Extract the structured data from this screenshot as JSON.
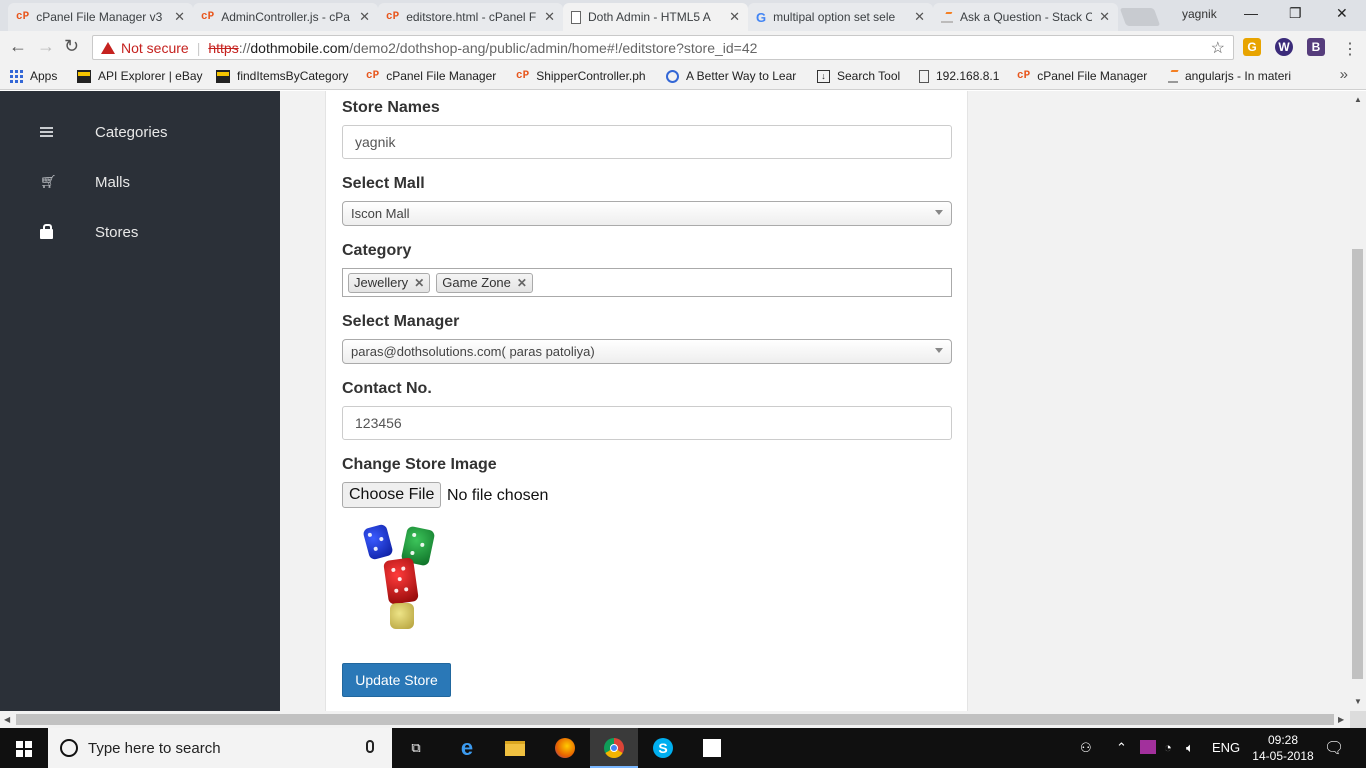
{
  "browser": {
    "tabs": [
      {
        "title": "cPanel File Manager v3",
        "favicon": "cpanel-icon"
      },
      {
        "title": "AdminController.js - cPa",
        "favicon": "cpanel-icon"
      },
      {
        "title": "editstore.html - cPanel F",
        "favicon": "cpanel-icon"
      },
      {
        "title": "Doth Admin - HTML5 A",
        "favicon": "page-icon",
        "active": true
      },
      {
        "title": "multipal option set sele",
        "favicon": "google-icon"
      },
      {
        "title": "Ask a Question - Stack O",
        "favicon": "stackoverflow-icon"
      }
    ],
    "profile_name": "yagnik",
    "security_label": "Not secure",
    "url_scheme": "https",
    "url_sep": "://",
    "url_host": "dothmobile.com",
    "url_rest": "/demo2/dothshop-ang/public/admin/home#!/editstore?store_id=42",
    "extensions": [
      "G",
      "W",
      "B"
    ],
    "bookmarks": [
      {
        "label": "Apps",
        "icon": "apps-grid-icon"
      },
      {
        "label": "API Explorer | eBay",
        "icon": "ebay-icon"
      },
      {
        "label": "findItemsByCategory",
        "icon": "ebay-icon"
      },
      {
        "label": "cPanel File Manager",
        "icon": "cpanel-icon"
      },
      {
        "label": "ShipperController.ph",
        "icon": "cpanel-icon"
      },
      {
        "label": "A Better Way to Lear",
        "icon": "globe-icon"
      },
      {
        "label": "Search Tool",
        "icon": "download-icon"
      },
      {
        "label": "192.168.8.1",
        "icon": "page-icon"
      },
      {
        "label": "cPanel File Manager",
        "icon": "cpanel-icon"
      },
      {
        "label": "angularjs - In materi",
        "icon": "stackoverflow-icon"
      }
    ]
  },
  "sidebar": {
    "items": [
      {
        "label": "Categories",
        "icon": "list-icon"
      },
      {
        "label": "Malls",
        "icon": "cart-icon"
      },
      {
        "label": "Stores",
        "icon": "shopping-bag-icon"
      }
    ]
  },
  "form": {
    "store_name": {
      "label": "Store Names",
      "value": "yagnik"
    },
    "mall": {
      "label": "Select Mall",
      "selected": "Iscon Mall"
    },
    "category": {
      "label": "Category",
      "selected": [
        "Jewellery",
        "Game Zone"
      ]
    },
    "manager": {
      "label": "Select Manager",
      "selected": "paras@dothsolutions.com( paras patoliya)"
    },
    "contact": {
      "label": "Contact No.",
      "value": "123456"
    },
    "image": {
      "label": "Change Store Image",
      "button": "Choose File",
      "status": "No file chosen",
      "preview": "dice-image"
    },
    "submit_label": "Update Store"
  },
  "taskbar": {
    "search_placeholder": "Type here to search",
    "language": "ENG",
    "time": "09:28",
    "date": "14-05-2018"
  },
  "colors": {
    "sidebar_bg": "#2b3038",
    "primary_button": "#2a78b7",
    "not_secure": "#c5221f"
  }
}
